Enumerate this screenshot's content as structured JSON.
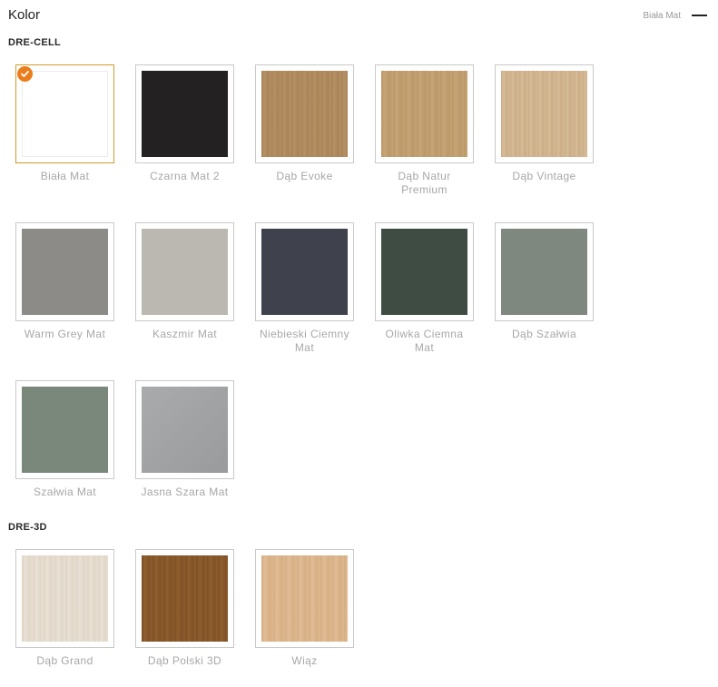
{
  "header": {
    "title": "Kolor",
    "selected_value": "Biała Mat"
  },
  "sections": [
    {
      "title": "DRE-CELL",
      "items": [
        {
          "label": "Biała Mat",
          "color": "#ffffff",
          "selected": true
        },
        {
          "label": "Czarna Mat 2",
          "color": "#242122"
        },
        {
          "label": "Dąb Evoke",
          "color": "#b08a5c"
        },
        {
          "label": "Dąb Natur Premium",
          "color": "#c29e6d"
        },
        {
          "label": "Dąb Vintage",
          "color": "#d2b58e"
        },
        {
          "label": "Warm Grey Mat",
          "color": "#8d8b88"
        },
        {
          "label": "Kaszmir Mat",
          "color": "#bbb8b2"
        },
        {
          "label": "Niebieski Ciemny Mat",
          "color": "#3f424c"
        },
        {
          "label": "Oliwka Ciemna Mat",
          "color": "#3e4c43"
        },
        {
          "label": "Dąb Szałwia",
          "color": "#7f887e"
        },
        {
          "label": "Szałwia Mat",
          "color": "#7a887c"
        },
        {
          "label": "Jasna Szara Mat",
          "color": "#9fa1a3"
        }
      ]
    },
    {
      "title": "DRE-3D",
      "items": [
        {
          "label": "Dąb Grand",
          "color": "#e6ddd0"
        },
        {
          "label": "Dąb Polski 3D",
          "color": "#8a5a2b"
        },
        {
          "label": "Wiąz",
          "color": "#dcb58b"
        }
      ]
    }
  ]
}
